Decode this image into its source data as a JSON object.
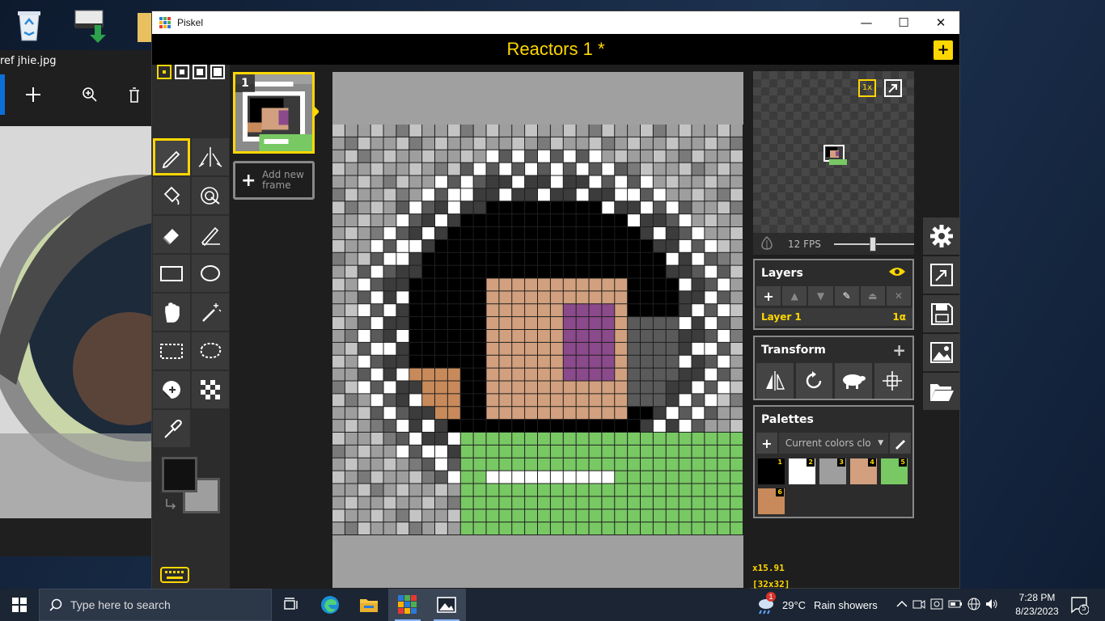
{
  "desktop": {
    "photo_viewer": {
      "filename": "ref jhie.jpg"
    }
  },
  "window": {
    "title": "Piskel",
    "minimize": "—",
    "maximize": "☐",
    "close": "✕"
  },
  "header": {
    "document_title": "Reactors 1 *",
    "new_button": "+"
  },
  "frames": {
    "current_index": "1",
    "add_label": "Add new frame"
  },
  "preview": {
    "zoom_button": "1x",
    "fps_label": "12 FPS",
    "fps_value": 12
  },
  "layers": {
    "title": "Layers",
    "items": [
      {
        "name": "Layer 1",
        "opacity": "1α"
      }
    ]
  },
  "transform": {
    "title": "Transform"
  },
  "palettes": {
    "title": "Palettes",
    "selected": "Current colors clo",
    "swatches": [
      {
        "num": "1",
        "color": "#000000"
      },
      {
        "num": "2",
        "color": "#ffffff"
      },
      {
        "num": "3",
        "color": "#9e9e9e"
      },
      {
        "num": "4",
        "color": "#d2a07e"
      },
      {
        "num": "5",
        "color": "#78c864"
      },
      {
        "num": "6",
        "color": "#c88a5a"
      }
    ]
  },
  "status": {
    "zoom": "x15.91",
    "size": "[32x32]"
  },
  "colors": {
    "primary": "#111111",
    "secondary": "#9e9e9e",
    "accent": "#ffd700"
  },
  "taskbar": {
    "search_placeholder": "Type here to search",
    "weather_temp": "29°C",
    "weather_text": "Rain showers",
    "weather_badge": "1",
    "time": "7:28 PM",
    "date": "8/23/2023",
    "notification_count": "5"
  }
}
